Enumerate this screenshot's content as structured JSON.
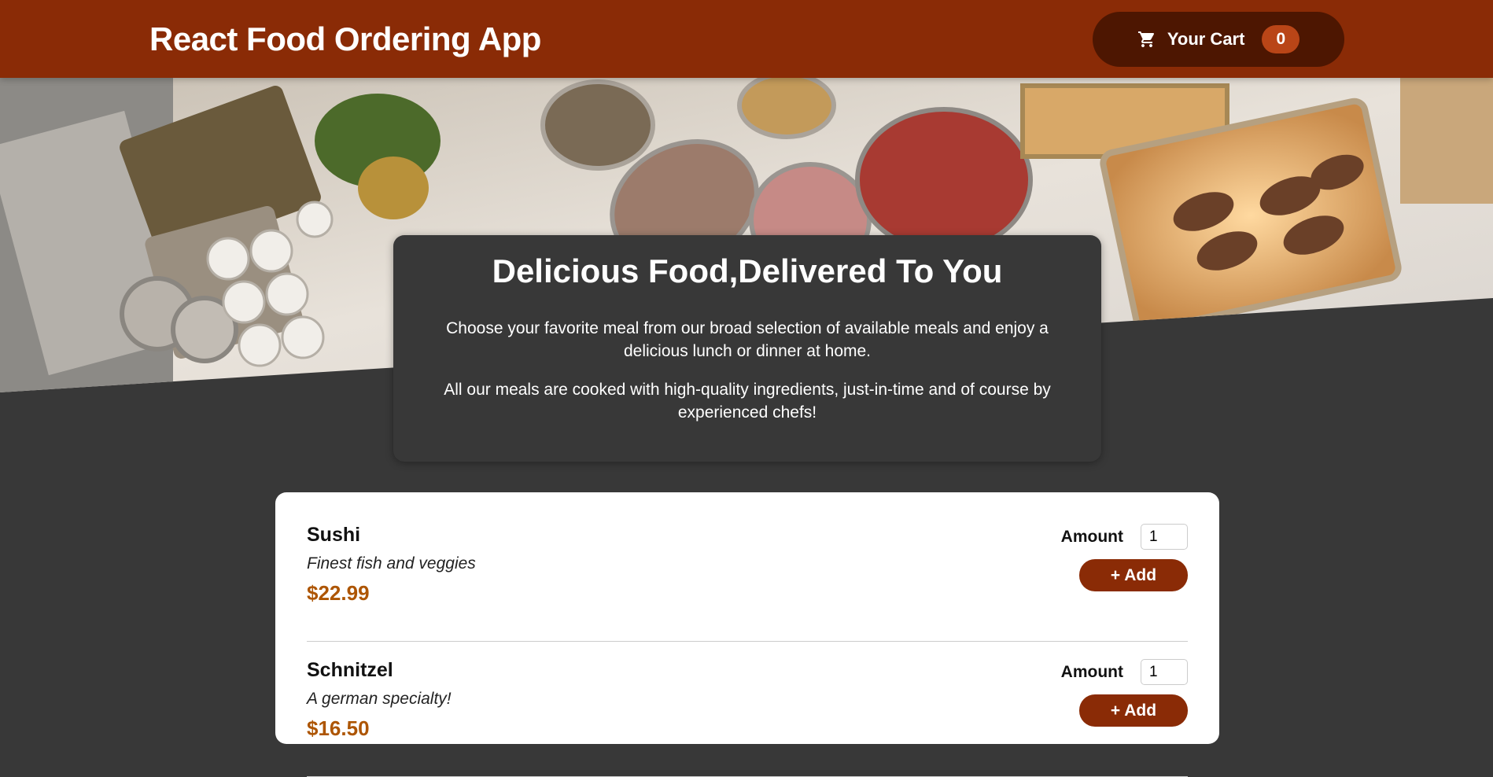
{
  "header": {
    "title": "React Food Ordering App",
    "cart_label": "Your Cart",
    "cart_count": "0",
    "cart_icon": "cart-icon"
  },
  "summary": {
    "heading": "Delicious Food,Delivered To You",
    "paragraph1": "Choose your favorite meal from our broad selection of available meals and enjoy a delicious lunch or dinner at home.",
    "paragraph2": "All our meals are cooked with high-quality ingredients, just-in-time and of course by experienced chefs!"
  },
  "meals": [
    {
      "name": "Sushi",
      "description": "Finest fish and veggies",
      "price": "$22.99",
      "amount_label": "Amount",
      "amount_value": "1",
      "add_label": "+ Add"
    },
    {
      "name": "Schnitzel",
      "description": "A german specialty!",
      "price": "$16.50",
      "amount_label": "Amount",
      "amount_value": "1",
      "add_label": "+ Add"
    }
  ],
  "colors": {
    "header_bg": "#8a2b06",
    "cart_bg": "#4d1601",
    "badge_bg": "#b94517",
    "page_bg": "#383838",
    "price": "#ad5502"
  }
}
